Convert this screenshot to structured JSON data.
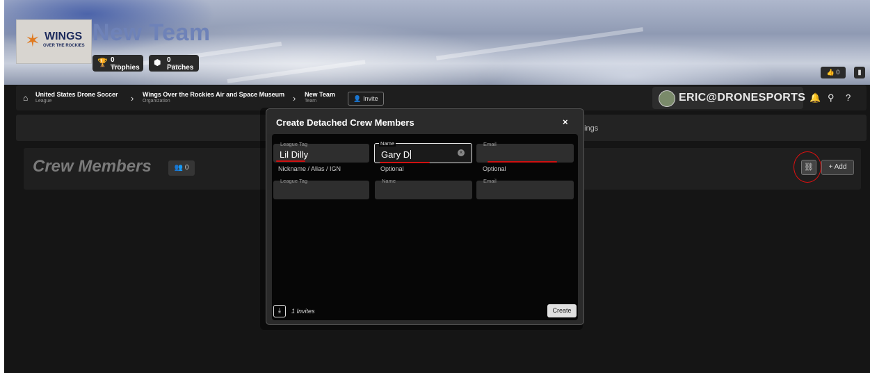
{
  "team": {
    "logo_title": "WINGS",
    "logo_subtitle": "OVER THE ROCKIES",
    "name": "New Team",
    "trophies": {
      "label": "0 Trophies",
      "sub": "Won"
    },
    "patches": {
      "label": "0 Patches",
      "sub": "Earned"
    },
    "likes": "0"
  },
  "breadcrumb": {
    "league": {
      "label": "United States Drone Soccer",
      "type": "League"
    },
    "organization": {
      "label": "Wings Over the Rockies Air and Space Museum",
      "type": "Organization"
    },
    "team": {
      "label": "New Team",
      "type": "Team"
    },
    "invite_label": "Invite"
  },
  "user": {
    "name": "ERIC@DRONESPORTS"
  },
  "tabs": {
    "settings_partial": "ttings"
  },
  "crew": {
    "title": "Crew Members",
    "count": "0",
    "add_label": "+ Add"
  },
  "modal": {
    "title": "Create Detached Crew Members",
    "close": "×",
    "rows": [
      {
        "league_tag": {
          "label": "League Tag",
          "value": "Lil Dilly",
          "helper": "Nickname / Alias / IGN"
        },
        "name": {
          "label": "Name",
          "value": "Gary D",
          "helper": "Optional"
        },
        "email": {
          "label": "Email",
          "value": "",
          "helper": "Optional"
        }
      },
      {
        "league_tag": {
          "label": "League Tag",
          "value": ""
        },
        "name": {
          "label": "Name",
          "value": ""
        },
        "email": {
          "label": "Email",
          "value": ""
        }
      }
    ],
    "invites": "1 Invites",
    "create_label": "Create"
  },
  "colors": {
    "annotation": "#d01010",
    "accent_team_name": "#6e82b8"
  }
}
